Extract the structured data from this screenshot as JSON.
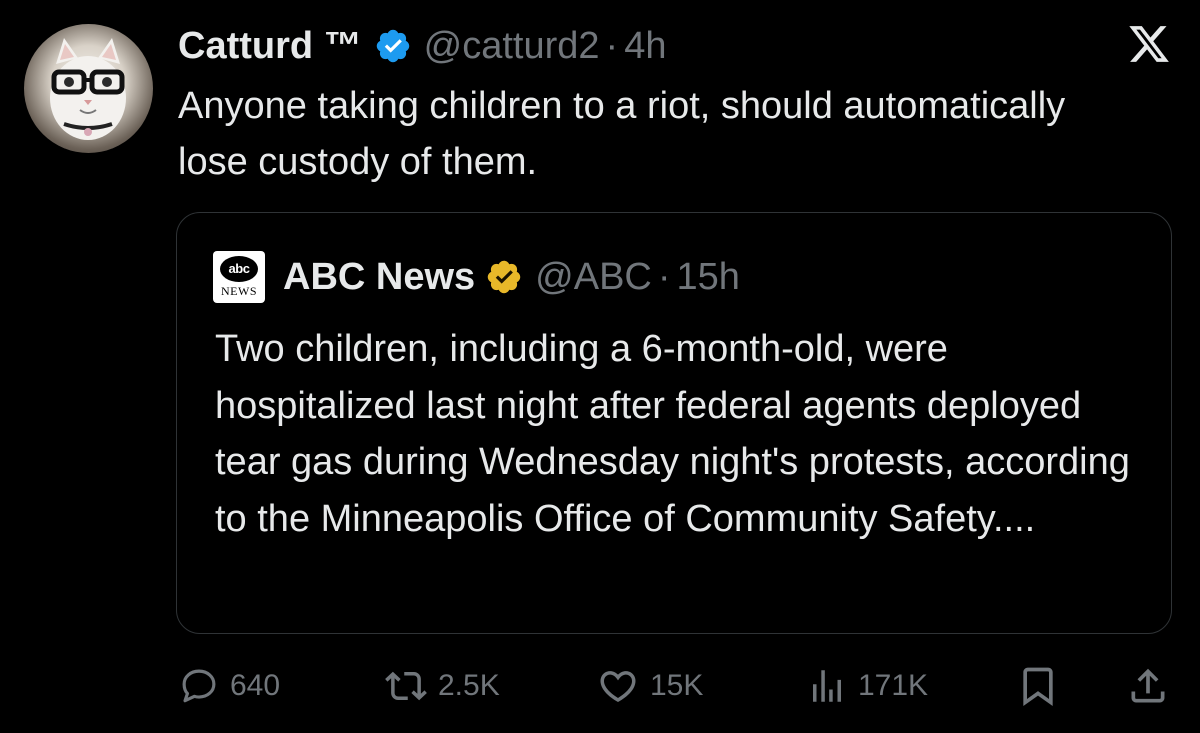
{
  "tweet": {
    "author": {
      "display_name": "Catturd ™",
      "handle": "@catturd2",
      "avatar_icon": "cat-with-glasses-avatar",
      "verified": true
    },
    "separator": "·",
    "time": "4h",
    "text": "Anyone taking children to a riot, should automatically lose custody of them.",
    "platform_icon": "x-logo-icon"
  },
  "quote": {
    "author": {
      "display_name": "ABC News",
      "handle": "@ABC",
      "logo_text_top": "abc",
      "logo_text_bottom": "NEWS",
      "verified": true
    },
    "separator": "·",
    "time": "15h",
    "text": "Two children, including a 6-month-old, were hospitalized last night after federal agents deployed tear gas during Wednesday night's protests, according to the Minneapolis Office of Community Safety...."
  },
  "actions": {
    "replies": "640",
    "reposts": "2.5K",
    "likes": "15K",
    "views": "171K"
  },
  "colors": {
    "background": "#000000",
    "text_primary": "#e7e9ea",
    "text_secondary": "#71767b",
    "border": "#2f3336",
    "verified_blue": "#1d9bf0",
    "verified_gold": "#e8b829"
  }
}
